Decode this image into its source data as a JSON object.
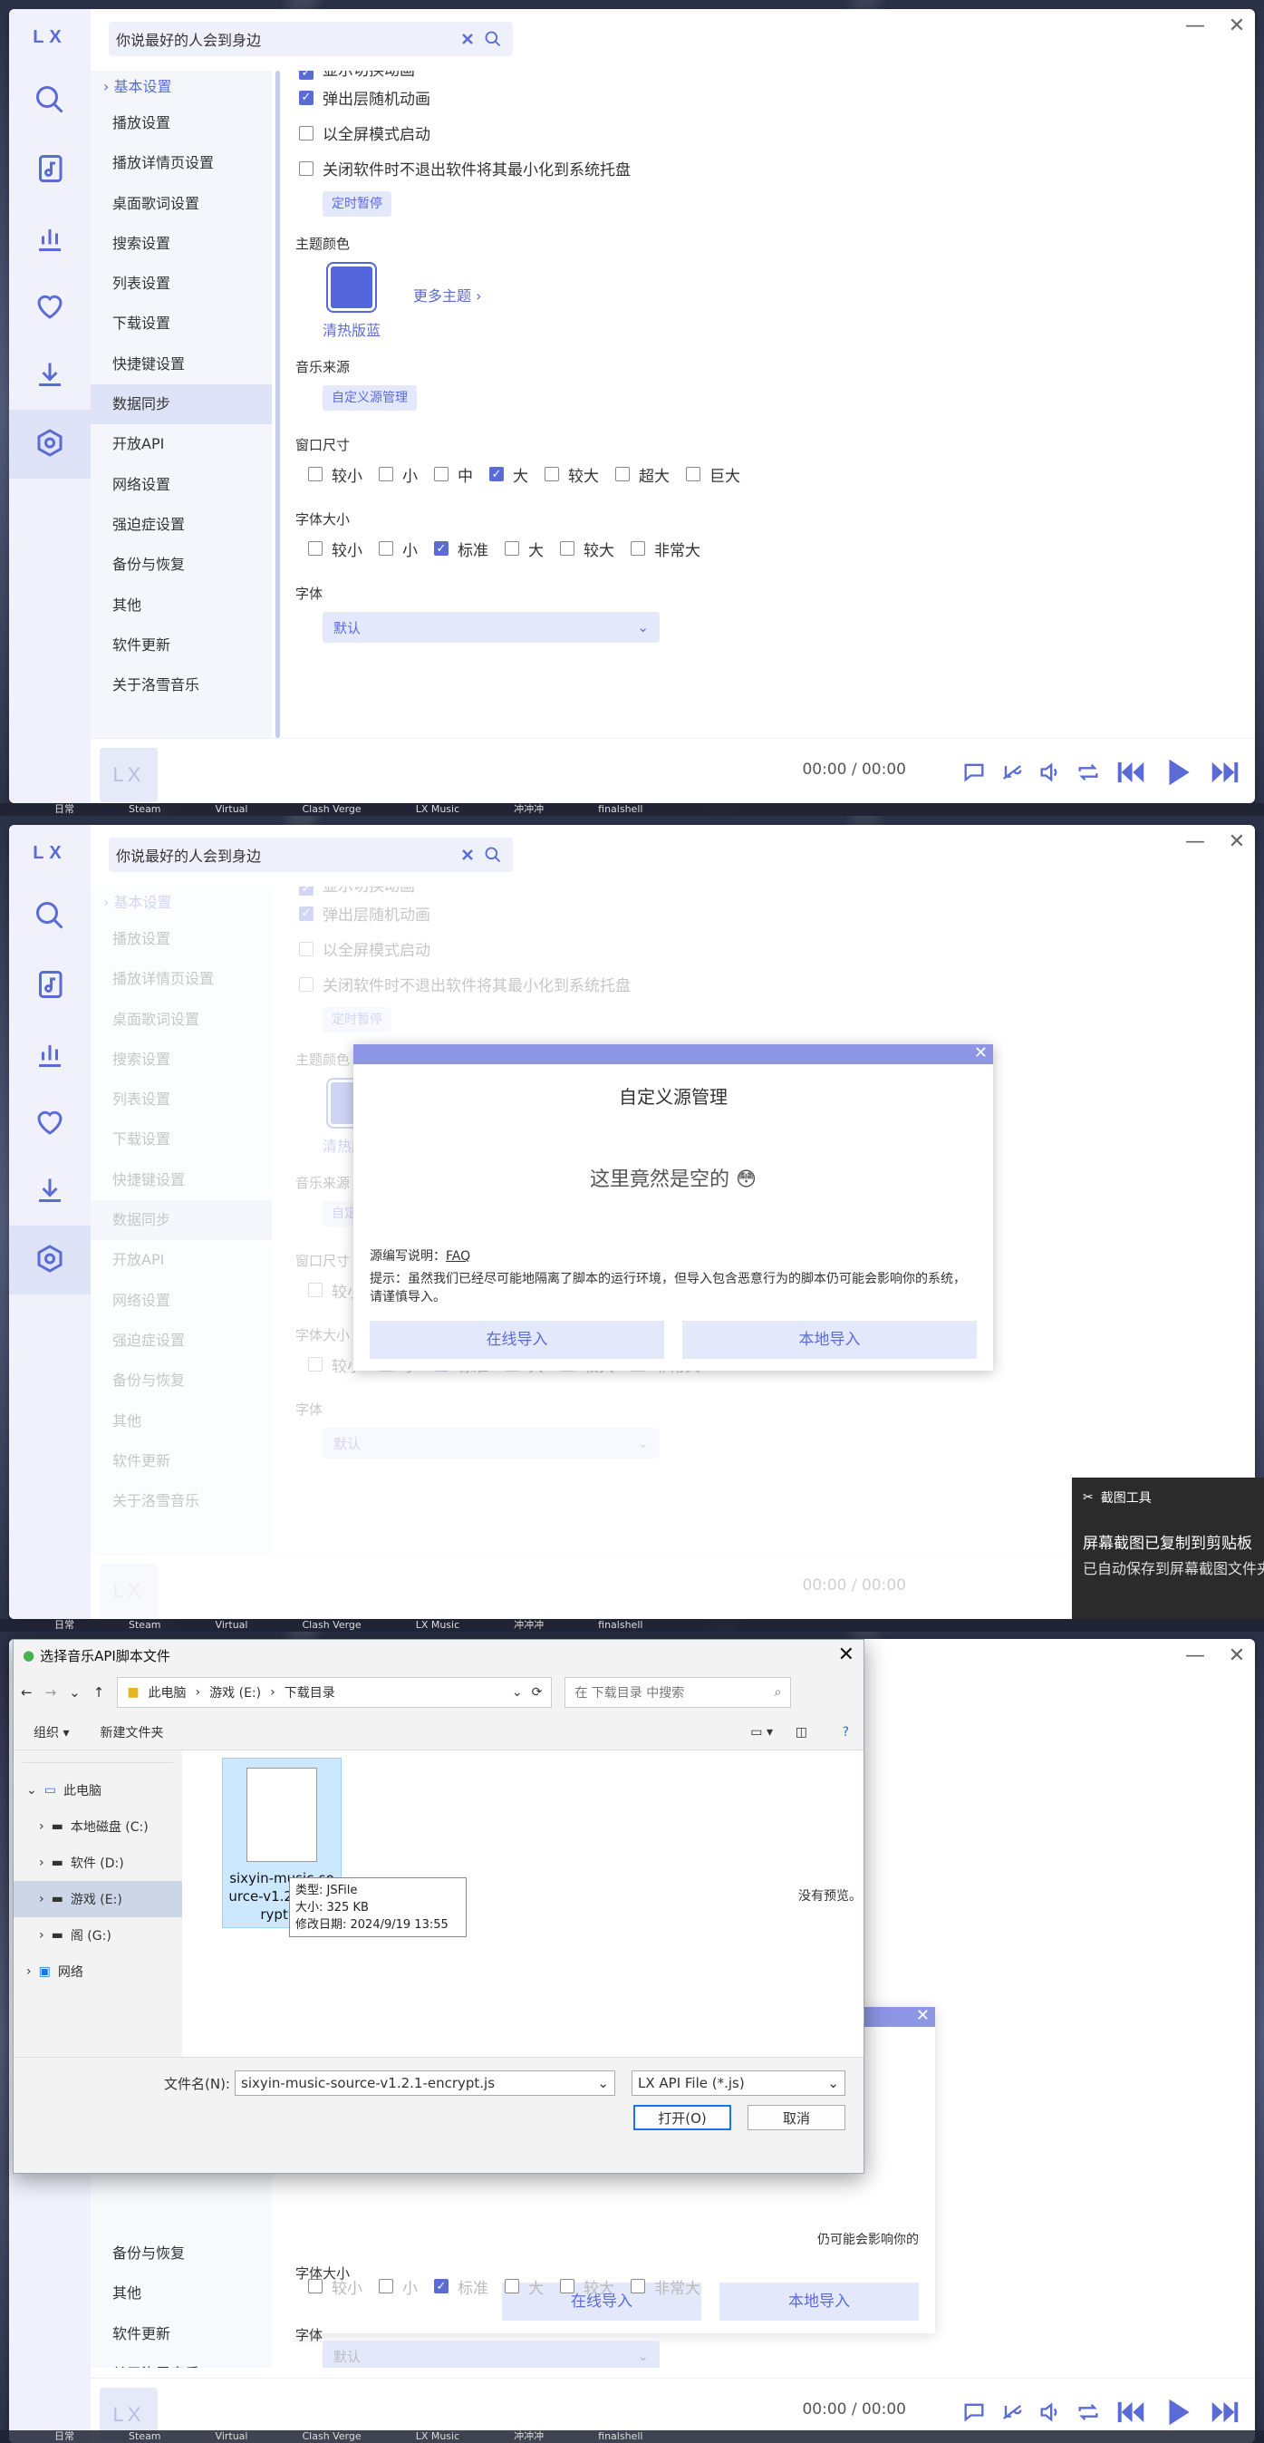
{
  "app": {
    "logo": "LX",
    "search_value": "你说最好的人会到身边",
    "win_min": "—",
    "win_close": "✕"
  },
  "settings_nav": [
    "基本设置",
    "播放设置",
    "播放详情页设置",
    "桌面歌词设置",
    "搜索设置",
    "列表设置",
    "下载设置",
    "快捷键设置",
    "数据同步",
    "开放API",
    "网络设置",
    "强迫症设置",
    "备份与恢复",
    "其他",
    "软件更新",
    "关于洛雪音乐"
  ],
  "settings_nav_first_marker": "›",
  "basic": {
    "partial_top": "显示切换动画",
    "popup_anim": "弹出层随机动画",
    "fullscreen": "以全屏模式启动",
    "tray": "关闭软件时不退出软件将其最小化到系统托盘",
    "timer_pause": "定时暂停",
    "theme_title": "主题颜色",
    "theme_name": "清热版蓝",
    "more_themes": "更多主题",
    "source_title": "音乐来源",
    "source_btn": "自定义源管理",
    "window_size_title": "窗口尺寸",
    "window_sizes": [
      "较小",
      "小",
      "中",
      "大",
      "较大",
      "超大",
      "巨大"
    ],
    "window_selected": "大",
    "font_size_title": "字体大小",
    "font_sizes": [
      "较小",
      "小",
      "标准",
      "大",
      "较大",
      "非常大"
    ],
    "font_selected": "标准",
    "font_title": "字体",
    "font_value": "默认"
  },
  "player": {
    "thumb": "LX",
    "time": "00:00 / 00:00"
  },
  "taskbar_items": [
    "日常",
    "Steam",
    "Virtual",
    "Clash Verge",
    "LX Music",
    "冲冲冲",
    "finalshell"
  ],
  "dialog": {
    "close": "✕",
    "title": "自定义源管理",
    "empty": "这里竟然是空的 😳",
    "note_label": "源编写说明：",
    "note_link": "FAQ",
    "warn": "提示：虽然我们已经尽可能地隔离了脚本的运行环境，但导入包含恶意行为的脚本仍可能会影响你的系统，请谨慎导入。",
    "btn_online": "在线导入",
    "btn_local": "本地导入"
  },
  "toast": {
    "app": "截图工具",
    "line1": "屏幕截图已复制到剪贴板",
    "line2": "已自动保存到屏幕截图文件夹"
  },
  "filedlg": {
    "title": "选择音乐API脚本文件",
    "close": "✕",
    "crumbs": [
      "此电脑",
      "游戏 (E:)",
      "下载目录"
    ],
    "search_placeholder": "在 下载目录 中搜索",
    "organize": "组织 ▾",
    "new_folder": "新建文件夹",
    "tree": [
      {
        "label": "此电脑",
        "level": 0,
        "expand": "⌄"
      },
      {
        "label": "本地磁盘 (C:)",
        "level": 1,
        "expand": "›"
      },
      {
        "label": "软件 (D:)",
        "level": 1,
        "expand": "›"
      },
      {
        "label": "游戏 (E:)",
        "level": 1,
        "expand": "›"
      },
      {
        "label": "阁 (G:)",
        "level": 1,
        "expand": "›"
      },
      {
        "label": "网络",
        "level": 0,
        "expand": "›"
      }
    ],
    "file_name": "sixyin-music-source-v1.2.1-encrypt.js",
    "file_label": "sixyin-music-so urce-v1.2.1-enc rypt.js",
    "tip_type": "类型: JSFile",
    "tip_size": "大小: 325 KB",
    "tip_date": "修改日期: 2024/9/19 13:55",
    "no_preview": "没有预览。",
    "filename_label": "文件名(N):",
    "filter": "LX API File (*.js)",
    "open_btn": "打开(O)",
    "cancel_btn": "取消"
  },
  "behind_warn_tail": "仍可能会影响你的"
}
